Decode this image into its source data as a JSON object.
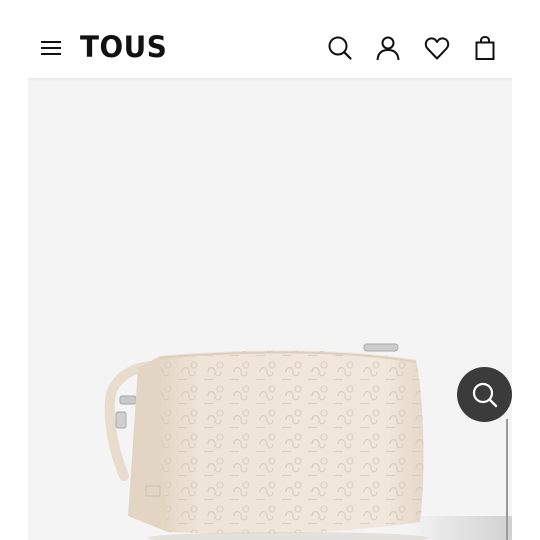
{
  "header": {
    "logo_text": "TOUS",
    "menu_icon": "hamburger-menu-icon",
    "icons": [
      "search-icon",
      "user-account-icon",
      "heart-icon",
      "shopping-bag-icon"
    ]
  },
  "product": {
    "image_description_icon": "product-image",
    "bag_color": "#efe4d8"
  },
  "visual_search_button": {
    "icon": "visual-search-icon",
    "color": "#3b3b3b"
  },
  "colors": {
    "background": "#f4f4f4",
    "header": "#ffffff",
    "text": "#111111"
  }
}
